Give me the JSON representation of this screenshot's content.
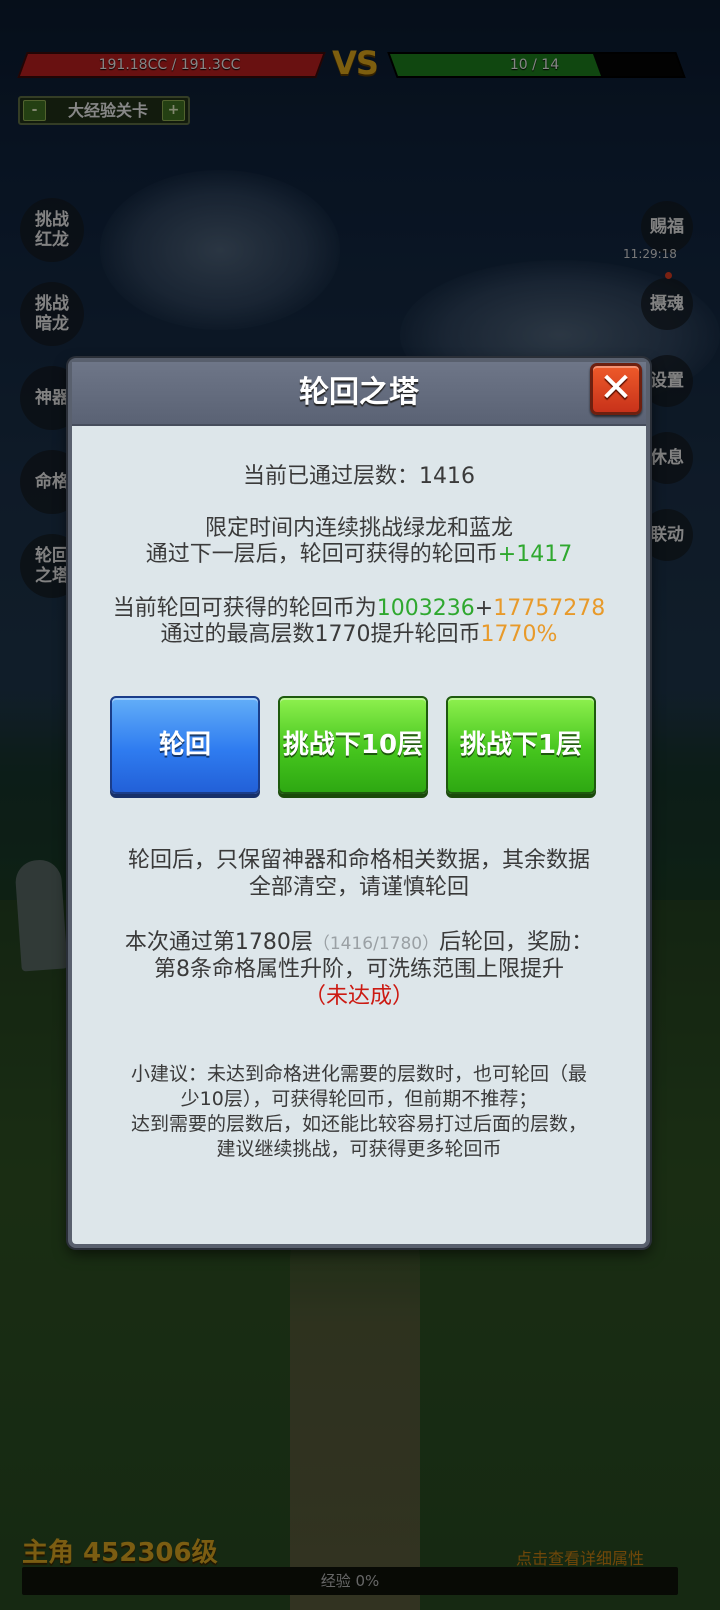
{
  "hud": {
    "player_hp": "191.18CC / 191.3CC",
    "player_hp_fraction": 0.999,
    "vs": "VS",
    "enemy_hp": "10 / 14",
    "enemy_hp_fraction": 0.714,
    "stage_minus": "-",
    "stage_label": "大经验关卡",
    "stage_plus": "+"
  },
  "left_menu": [
    {
      "line1": "挑战",
      "line2": "红龙"
    },
    {
      "line1": "挑战",
      "line2": "暗龙"
    },
    {
      "line1": "神器",
      "line2": ""
    },
    {
      "line1": "命格",
      "line2": ""
    },
    {
      "line1": "轮回",
      "line2": "之塔"
    }
  ],
  "right_menu": [
    {
      "label": "赐福"
    },
    {
      "label": "摄魂"
    },
    {
      "label": "设置"
    },
    {
      "label": "休息"
    },
    {
      "label": "联动"
    }
  ],
  "timer": "11:29:18",
  "bottom": {
    "hero_level": "主角 452306级",
    "detail_link": "点击查看详细属性",
    "exp_text": "经验 0%"
  },
  "dialog": {
    "title": "轮回之塔",
    "close_icon": "✕",
    "current_floor_label": "当前已通过层数：",
    "current_floor_value": "1416",
    "desc_line1": "限定时间内连续挑战绿龙和蓝龙",
    "desc_line2_prefix": "通过下一层后，轮回可获得的轮回币",
    "desc_line2_value": "+1417",
    "coins_prefix": "当前轮回可获得的轮回币为",
    "coins_base": "1003236",
    "coins_plus": "+",
    "coins_bonus": "17757278",
    "best_prefix": "通过的最高层数1770提升轮回币",
    "best_value": "1770%",
    "buttons": {
      "rebirth": "轮回",
      "challenge10": "挑战下10层",
      "challenge1": "挑战下1层"
    },
    "warning_line1": "轮回后，只保留神器和命格相关数据，其余数据",
    "warning_line2": "全部清空，请谨慎轮回",
    "reward_prefix": "本次通过第1780层",
    "reward_progress": "（1416/1780）",
    "reward_suffix": "后轮回，奖励：",
    "reward_line2": "第8条命格属性升阶，可洗练范围上限提升",
    "reward_status": "（未达成）",
    "tip_line1": "小建议：未达到命格进化需要的层数时，也可轮回（最",
    "tip_line2": "少10层），可获得轮回币，但前期不推荐；",
    "tip_line3": "达到需要的层数后，如还能比较容易打过后面的层数，",
    "tip_line4": "建议继续挑战，可获得更多轮回币"
  }
}
